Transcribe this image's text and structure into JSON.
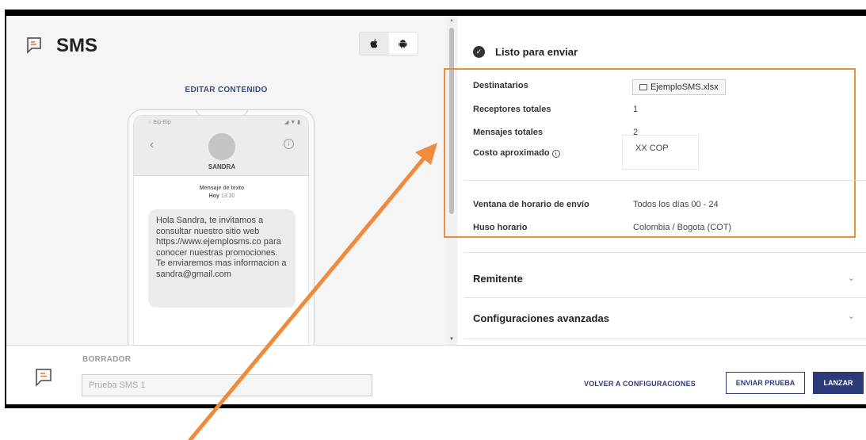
{
  "header": {
    "title": "SMS",
    "title_icon": "message-icon",
    "os_options": [
      "apple-icon",
      "android-icon"
    ],
    "edit_link": "EDITAR CONTENIDO"
  },
  "phone": {
    "carrier": "Bip-Bip",
    "contact_name": "SANDRA",
    "message_kind": "Mensaje de texto",
    "message_day": "Hoy",
    "message_time": "13:30",
    "message_body": "Hola Sandra, te invitamos a consultar nuestro sitio web https://www.ejemplosms.co para conocer nuestras promociones. Te enviaremos mas informacion a sandra@gmail.com"
  },
  "summary": {
    "status": "Listo para enviar",
    "recipients_label": "Destinatarios",
    "recipients_file": "EjemploSMS.xlsx",
    "total_receivers_label": "Receptores totales",
    "total_receivers": "1",
    "total_messages_label": "Mensajes totales",
    "total_messages": "2",
    "cost_label": "Costo aproximado",
    "cost_value": "XX COP",
    "window_label": "Ventana de horario de envío",
    "window_value": "Todos los días 00 - 24",
    "timezone_label": "Huso horario",
    "timezone_value": "Colombia / Bogota (COT)"
  },
  "sections": {
    "sender": "Remitente",
    "advanced": "Configuraciones avanzadas"
  },
  "footer": {
    "draft_label": "BORRADOR",
    "draft_value": "Prueba SMS 1",
    "back_button": "VOLVER A CONFIGURACIONES",
    "test_button": "ENVIAR PRUEBA",
    "launch_button": "LANZAR"
  },
  "colors": {
    "accent": "#2c3a7a",
    "highlight": "#f08a3c",
    "brand_icon": "#e8762b"
  }
}
